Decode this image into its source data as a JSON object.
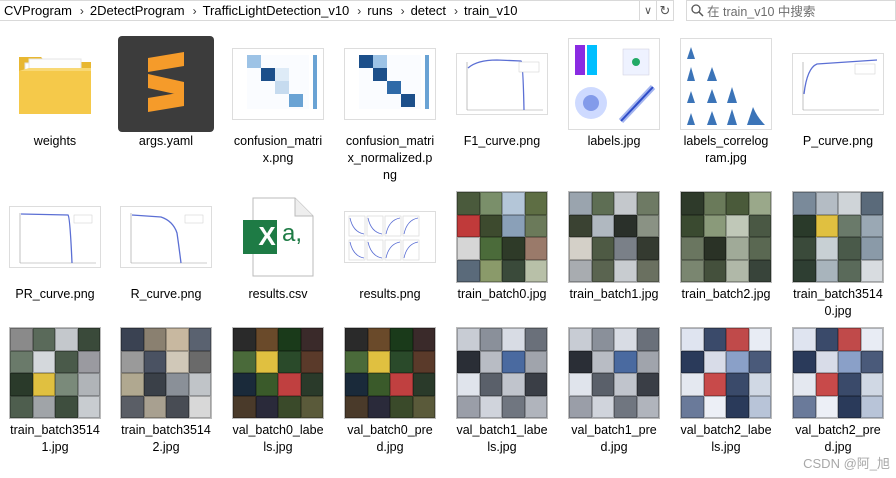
{
  "address": {
    "crumbs": [
      "CVProgram",
      "2DetectProgram",
      "TrafficLightDetection_v10",
      "runs",
      "detect",
      "train_v10"
    ],
    "dropdown_glyph": "∨",
    "refresh_glyph": "↻"
  },
  "search": {
    "placeholder": "在 train_v10 中搜索"
  },
  "files": [
    {
      "name": "weights",
      "label_lines": [
        "weights"
      ],
      "kind": "folder"
    },
    {
      "name": "args.yaml",
      "label_lines": [
        "args.yaml"
      ],
      "kind": "sublime"
    },
    {
      "name": "confusion_matrix.png",
      "label_lines": [
        "confusion_matri",
        "x.png"
      ],
      "kind": "confusion"
    },
    {
      "name": "confusion_matrix_normalized.png",
      "label_lines": [
        "confusion_matri",
        "x_normalized.p",
        "ng"
      ],
      "kind": "confusion-norm"
    },
    {
      "name": "F1_curve.png",
      "label_lines": [
        "F1_curve.png"
      ],
      "kind": "curve-down"
    },
    {
      "name": "labels.jpg",
      "label_lines": [
        "labels.jpg"
      ],
      "kind": "labels"
    },
    {
      "name": "labels_correlogram.jpg",
      "label_lines": [
        "labels_correlog",
        "ram.jpg"
      ],
      "kind": "correlogram"
    },
    {
      "name": "P_curve.png",
      "label_lines": [
        "P_curve.png"
      ],
      "kind": "curve-up"
    },
    {
      "name": "PR_curve.png",
      "label_lines": [
        "PR_curve.png"
      ],
      "kind": "curve-flat"
    },
    {
      "name": "R_curve.png",
      "label_lines": [
        "R_curve.png"
      ],
      "kind": "curve-decline"
    },
    {
      "name": "results.csv",
      "label_lines": [
        "results.csv"
      ],
      "kind": "excel"
    },
    {
      "name": "results.png",
      "label_lines": [
        "results.png"
      ],
      "kind": "results"
    },
    {
      "name": "train_batch0.jpg",
      "label_lines": [
        "train_batch0.jpg"
      ],
      "kind": "mosaic-a"
    },
    {
      "name": "train_batch1.jpg",
      "label_lines": [
        "train_batch1.jpg"
      ],
      "kind": "mosaic-b"
    },
    {
      "name": "train_batch2.jpg",
      "label_lines": [
        "train_batch2.jpg"
      ],
      "kind": "mosaic-c"
    },
    {
      "name": "train_batch35140.jpg",
      "label_lines": [
        "train_batch3514",
        "0.jpg"
      ],
      "kind": "mosaic-d"
    },
    {
      "name": "train_batch35141.jpg",
      "label_lines": [
        "train_batch3514",
        "1.jpg"
      ],
      "kind": "mosaic-e"
    },
    {
      "name": "train_batch35142.jpg",
      "label_lines": [
        "train_batch3514",
        "2.jpg"
      ],
      "kind": "mosaic-f"
    },
    {
      "name": "val_batch0_labels.jpg",
      "label_lines": [
        "val_batch0_labe",
        "ls.jpg"
      ],
      "kind": "mosaic-g"
    },
    {
      "name": "val_batch0_pred.jpg",
      "label_lines": [
        "val_batch0_pre",
        "d.jpg"
      ],
      "kind": "mosaic-g"
    },
    {
      "name": "val_batch1_labels.jpg",
      "label_lines": [
        "val_batch1_labe",
        "ls.jpg"
      ],
      "kind": "mosaic-h"
    },
    {
      "name": "val_batch1_pred.jpg",
      "label_lines": [
        "val_batch1_pre",
        "d.jpg"
      ],
      "kind": "mosaic-h"
    },
    {
      "name": "val_batch2_labels.jpg",
      "label_lines": [
        "val_batch2_labe",
        "ls.jpg"
      ],
      "kind": "mosaic-i"
    },
    {
      "name": "val_batch2_pred.jpg",
      "label_lines": [
        "val_batch2_pre",
        "d.jpg"
      ],
      "kind": "mosaic-i"
    }
  ],
  "excel_letter": "X",
  "excel_text": "a,",
  "watermark": "CSDN @阿_旭",
  "colors": {
    "folder": "#f5c94a",
    "sublime_bg": "#3c3c3c",
    "sublime_logo": "#f59b2a",
    "excel_green": "#1e7b45",
    "confusion_blue": "#1c4f8a",
    "curve": "#5b6fd4"
  }
}
